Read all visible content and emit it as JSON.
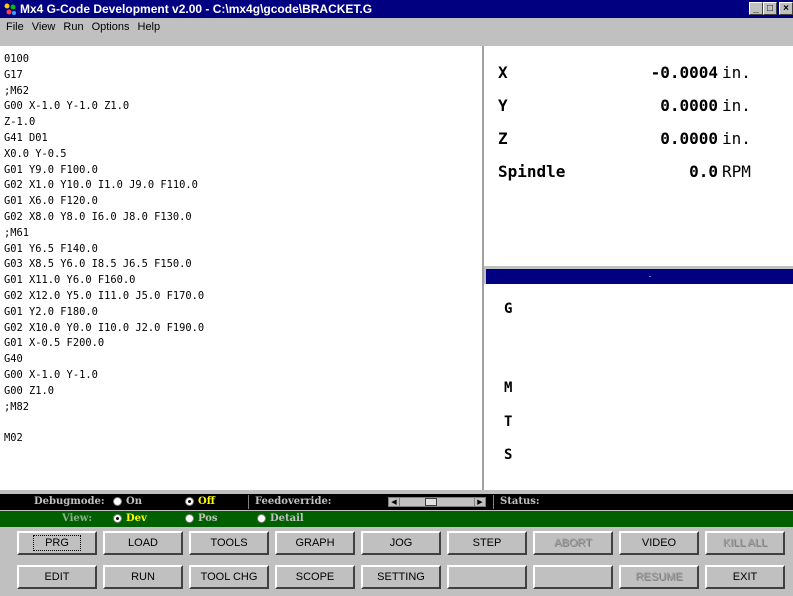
{
  "window": {
    "title": "Mx4 G-Code Development v2.00 - C:\\mx4g\\gcode\\BRACKET.G",
    "icon": "app-icon",
    "controls": [
      "minimize-icon",
      "maximize-icon",
      "close-icon"
    ]
  },
  "menu": [
    "File",
    "View",
    "Run",
    "Options",
    "Help"
  ],
  "code_lines": [
    "0100",
    "G17",
    ";M62",
    "G00 X-1.0 Y-1.0 Z1.0",
    "Z-1.0",
    "G41 D01",
    "X0.0 Y-0.5",
    "G01 Y9.0 F100.0",
    "G02 X1.0 Y10.0 I1.0 J9.0 F110.0",
    "G01 X6.0 F120.0",
    "G02 X8.0 Y8.0 I6.0 J8.0 F130.0",
    ";M61",
    "G01 Y6.5 F140.0",
    "G03 X8.5 Y6.0 I8.5 J6.5 F150.0",
    "G01 X11.0 Y6.0 F160.0",
    "G02 X12.0 Y5.0 I11.0 J5.0 F170.0",
    "G01 Y2.0 F180.0",
    "G02 X10.0 Y0.0 I10.0 J2.0 F190.0",
    "G01 X-0.5 F200.0",
    "G40",
    "G00 X-1.0 Y-1.0",
    "G00 Z1.0",
    ";M82",
    "",
    "M02"
  ],
  "coords": {
    "x": {
      "label": "X",
      "value": "-0.0004",
      "unit": "in."
    },
    "y": {
      "label": "Y",
      "value": "0.0000",
      "unit": "in."
    },
    "z": {
      "label": "Z",
      "value": "0.0000",
      "unit": "in."
    },
    "spindle": {
      "label": "Spindle",
      "value": "0.0",
      "unit": "RPM"
    }
  },
  "modal": {
    "g": "G",
    "m": "M",
    "t": "T",
    "s": "S"
  },
  "status": {
    "debugmode_label": "Debugmode:",
    "on_label": "On",
    "off_label": "Off",
    "feedoverride_label": "Feedoverride:",
    "status_label": "Status:",
    "view_label": "View:",
    "dev_label": "Dev",
    "pos_label": "Pos",
    "detail_label": "Detail",
    "feedoverride_level": 0.4,
    "colors": {
      "label": "#c0c0c0",
      "active": "#ffff00",
      "view_bg": "#006000"
    }
  },
  "buttons_row1": [
    {
      "label": "PRG",
      "enabled": true
    },
    {
      "label": "LOAD",
      "enabled": true
    },
    {
      "label": "TOOLS",
      "enabled": true
    },
    {
      "label": "GRAPH",
      "enabled": true
    },
    {
      "label": "JOG",
      "enabled": true
    },
    {
      "label": "STEP",
      "enabled": true
    },
    {
      "label": "ABORT",
      "enabled": false
    },
    {
      "label": "VIDEO",
      "enabled": true
    },
    {
      "label": "KILL ALL",
      "enabled": false
    }
  ],
  "buttons_row2": [
    {
      "label": "EDIT",
      "enabled": true
    },
    {
      "label": "RUN",
      "enabled": true
    },
    {
      "label": "TOOL CHG",
      "enabled": true
    },
    {
      "label": "SCOPE",
      "enabled": true
    },
    {
      "label": "SETTING",
      "enabled": true
    },
    {
      "label": "",
      "enabled": true
    },
    {
      "label": "",
      "enabled": true
    },
    {
      "label": "RESUME",
      "enabled": false
    },
    {
      "label": "EXIT",
      "enabled": true
    }
  ]
}
